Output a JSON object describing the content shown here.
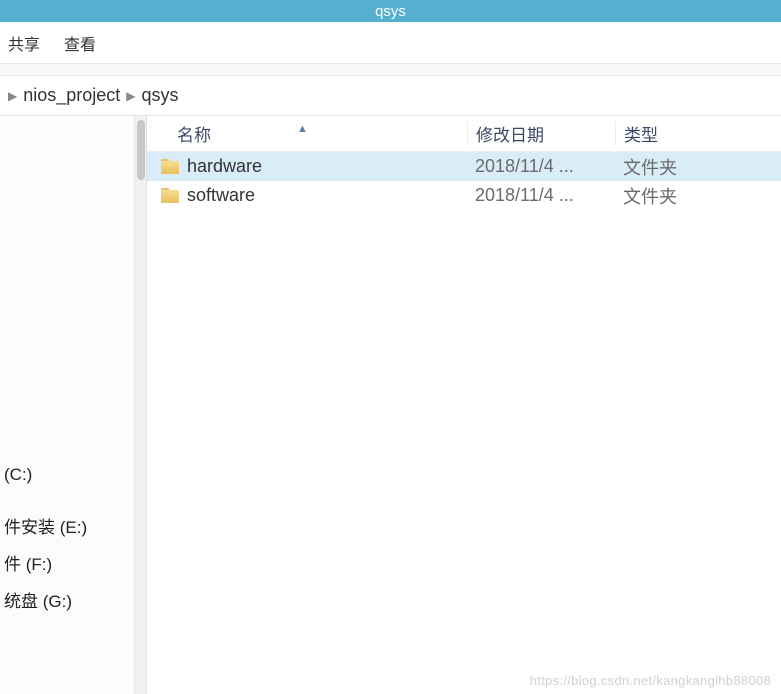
{
  "titlebar": {
    "title": "qsys"
  },
  "menubar": {
    "items": [
      "共享",
      "查看"
    ]
  },
  "breadcrumb": {
    "parts": [
      "nios_project",
      "qsys"
    ]
  },
  "columns": {
    "name": "名称",
    "date": "修改日期",
    "type": "类型"
  },
  "rows": [
    {
      "name": "hardware",
      "date": "2018/11/4 ...",
      "type": "文件夹",
      "selected": true
    },
    {
      "name": "software",
      "date": "2018/11/4 ...",
      "type": "文件夹",
      "selected": false
    }
  ],
  "sidebar": {
    "upper": [
      ""
    ],
    "drives": [
      "(C:)",
      "件安装 (E:)",
      "件 (F:)",
      "统盘 (G:)"
    ]
  },
  "watermark": "https://blog.csdn.net/kangkanglhb88008"
}
